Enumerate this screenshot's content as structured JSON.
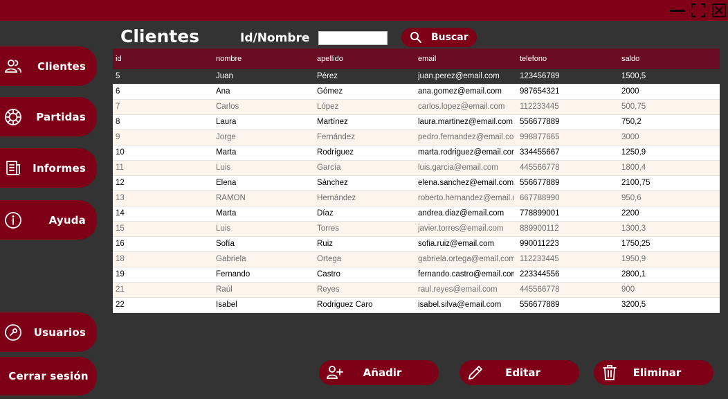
{
  "window": {
    "icons": [
      "minimize-icon",
      "maximize-icon",
      "close-icon"
    ]
  },
  "sidebar": {
    "items": [
      {
        "label": "Clientes",
        "icon": "users-icon"
      },
      {
        "label": "Partidas",
        "icon": "poker-chip-icon"
      },
      {
        "label": "Informes",
        "icon": "report-icon"
      },
      {
        "label": "Ayuda",
        "icon": "info-icon"
      },
      {
        "label": "Usuarios",
        "icon": "wrench-icon"
      },
      {
        "label": "Cerrar sesión"
      }
    ]
  },
  "header": {
    "title": "Clientes",
    "search_label": "Id/Nombre",
    "search_value": "",
    "search_button": "Buscar"
  },
  "table": {
    "columns": [
      "id",
      "nombre",
      "apellido",
      "email",
      "telefono",
      "saldo"
    ],
    "rows": [
      [
        "5",
        "Juan",
        "Pérez",
        "juan.perez@email.com",
        "123456789",
        "1500,5"
      ],
      [
        "6",
        "Ana",
        "Gómez",
        "ana.gomez@email.com",
        "987654321",
        "2000"
      ],
      [
        "7",
        "Carlos",
        "López",
        "carlos.lopez@email.com",
        "112233445",
        "500,75"
      ],
      [
        "8",
        "Laura",
        "Martínez",
        "laura.martinez@email.com",
        "556677889",
        "750,2"
      ],
      [
        "9",
        "Jorge",
        "Fernández",
        "pedro.fernandez@email.com",
        "998877665",
        "3000"
      ],
      [
        "10",
        "Marta",
        "Rodríguez",
        "marta.rodriguez@email.com",
        "334455667",
        "1250,9"
      ],
      [
        "11",
        "Luis",
        "García",
        "luis.garcia@email.com",
        "445566778",
        "1800,4"
      ],
      [
        "12",
        "Elena",
        "Sánchez",
        "elena.sanchez@email.com",
        "556677889",
        "2100,75"
      ],
      [
        "13",
        "RAMON",
        "Hernández",
        "roberto.hernandez@email.c...",
        "667788990",
        "950,6"
      ],
      [
        "14",
        "Marta",
        "Díaz",
        "andrea.diaz@email.com",
        "778899001",
        "2200"
      ],
      [
        "15",
        "Luis",
        "Torres",
        "javier.torres@email.com",
        "889900112",
        "1300,3"
      ],
      [
        "16",
        "Sofía",
        "Ruiz",
        "sofia.ruiz@email.com",
        "990011223",
        "1750,25"
      ],
      [
        "18",
        "Gabriela",
        "Ortega",
        "gabriela.ortega@email.com",
        "112233445",
        "1950,9"
      ],
      [
        "19",
        "Fernando",
        "Castro",
        "fernando.castro@email.com",
        "223344556",
        "2800,1"
      ],
      [
        "21",
        "Raúl",
        "Reyes",
        "raul.reyes@email.com",
        "445566778",
        "900"
      ],
      [
        "22",
        "Isabel",
        "Rodriguez Caro",
        "isabel.silva@email.com",
        "556677889",
        "3200,5"
      ]
    ]
  },
  "actions": {
    "add": "Añadir",
    "edit": "Editar",
    "delete": "Eliminar"
  },
  "colors": {
    "accent": "#7d0016",
    "titlebar": "#800018",
    "header": "#6b0d22",
    "background": "#333333",
    "row_alt": "#fdf5ec"
  }
}
